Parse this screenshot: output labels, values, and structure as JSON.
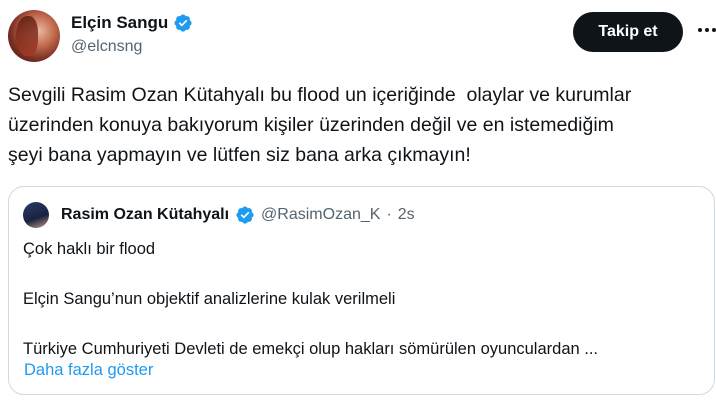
{
  "author": {
    "display_name": "Elçin Sangu",
    "handle": "@elcnsng",
    "verified_icon": "verified-badge-icon"
  },
  "actions": {
    "follow_label": "Takip et",
    "more_icon": "more-horizontal-icon"
  },
  "tweet": {
    "text": "Sevgili Rasim Ozan Kütahyalı bu flood un içeriğinde  olaylar ve kurumlar\nüzerinden konuya bakıyorum kişiler üzerinden değil ve en istemediğim\nşeyi bana yapmayın ve lütfen siz bana arka çıkmayın!"
  },
  "quote": {
    "display_name": "Rasim Ozan Kütahyalı",
    "handle": "@RasimOzan_K",
    "separator": "·",
    "time": "2s",
    "lines": [
      "Çok haklı bir flood",
      "Elçin Sangu’nun objektif analizlerine kulak verilmeli",
      "Türkiye Cumhuriyeti Devleti de emekçi olup hakları sömürülen oyunculardan ..."
    ],
    "show_more": "Daha fazla göster"
  },
  "colors": {
    "text": "#0f1419",
    "secondary": "#536471",
    "link": "#1d9bf0",
    "verified": "#1d9bf0",
    "border": "#cfd9de",
    "button_bg": "#0f1419"
  }
}
